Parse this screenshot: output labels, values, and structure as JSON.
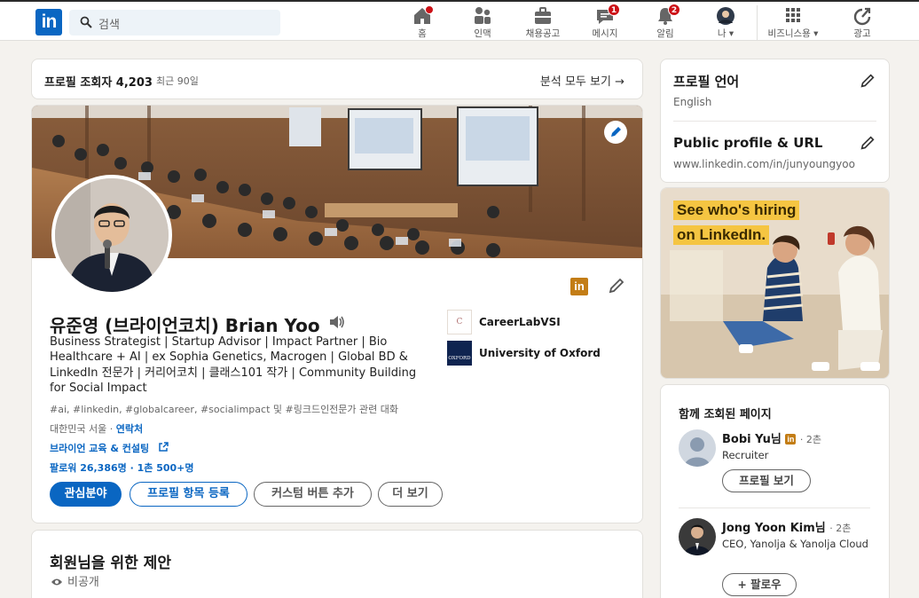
{
  "nav": {
    "search_placeholder": "검색",
    "items": [
      {
        "label": "홈",
        "badge": ""
      },
      {
        "label": "인맥",
        "badge": ""
      },
      {
        "label": "채용공고",
        "badge": ""
      },
      {
        "label": "메시지",
        "badge": "1"
      },
      {
        "label": "알림",
        "badge": "2"
      },
      {
        "label": "나",
        "badge": ""
      },
      {
        "label": "비즈니스용",
        "badge": ""
      },
      {
        "label": "광고",
        "badge": ""
      }
    ]
  },
  "viewers": {
    "label": "프로필 조회자 4,203",
    "period": "최근 90일",
    "link": "분석 모두 보기"
  },
  "profile": {
    "name": "유준영 (브라이언코치) Brian Yoo",
    "headline": "Business Strategist | Startup Advisor | Impact Partner | Bio Healthcare + AI | ex Sophia Genetics, Macrogen | Global BD & LinkedIn 전문가 | 커리어코치 | 클래스101 작가 | Community Building for Social Impact",
    "hashtags": "#ai, #linkedin, #globalcareer, #socialimpact 및 #링크드인전문가 관련 대화",
    "location": "대한민국 서울",
    "contact": "연락처",
    "website": "브라이언 교육 & 컨설팅",
    "followers": "팔로워 26,386명 · 1촌 500+명",
    "badge": "in",
    "orgs": [
      {
        "name": "CareerLabVSI",
        "logo_text": "C"
      },
      {
        "name": "University of Oxford",
        "logo_text": "OXFORD"
      }
    ],
    "buttons": {
      "interests": "관심분야",
      "add_section": "프로필 항목 등록",
      "custom": "커스텀 버튼 추가",
      "more": "더 보기"
    }
  },
  "suggest": {
    "title": "회원님을 위한 제안",
    "privacy": "비공개"
  },
  "sidebar": {
    "lang_title": "프로필 언어",
    "lang_value": "English",
    "url_title": "Public profile & URL",
    "url_value": "www.linkedin.com/in/junyoungyoo"
  },
  "ad": {
    "line1": "See who's hiring",
    "line2": "on LinkedIn."
  },
  "viewed": {
    "title": "함께 조회된 페이지",
    "people": [
      {
        "name": "Bobi Yu님",
        "degree": "· 2촌",
        "title": "Recruiter",
        "button": "프로필 보기"
      },
      {
        "name": "Jong Yoon Kim님",
        "degree": "· 2촌",
        "title": "CEO, Yanolja & Yanolja Cloud",
        "button": "+ 팔로우"
      }
    ]
  },
  "colors": {
    "brand": "#0a66c2",
    "badge_red": "#cc1016",
    "premium_gold": "#c37d16"
  }
}
